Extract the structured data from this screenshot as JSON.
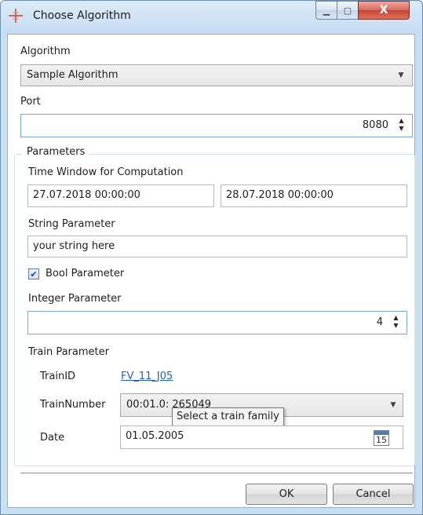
{
  "window": {
    "title": "Choose Algorithm",
    "controls": {
      "minimize": "▁",
      "maximize": "▢",
      "close": "X"
    }
  },
  "algorithm": {
    "label": "Algorithm",
    "selected": "Sample Algorithm"
  },
  "port": {
    "label": "Port",
    "value": "8080"
  },
  "parameters": {
    "group_label": "Parameters",
    "time_window": {
      "label": "Time Window for Computation",
      "start": "27.07.2018 00:00:00",
      "end": "28.07.2018 00:00:00"
    },
    "string_param": {
      "label": "String Parameter",
      "value": "your string here"
    },
    "bool_param": {
      "label": "Bool Parameter",
      "checked": true
    },
    "integer_param": {
      "label": "Integer Parameter",
      "value": "4"
    },
    "train": {
      "label": "Train Parameter",
      "train_id_label": "TrainID",
      "train_id_value": "FV_11_J05",
      "train_number_label": "TrainNumber",
      "train_number_value": "00:01.0: 265049",
      "train_number_tooltip": "Select a train family",
      "date_label": "Date",
      "date_value": "01.05.2005",
      "calendar_day": "15"
    }
  },
  "buttons": {
    "ok": "OK",
    "cancel": "Cancel"
  },
  "icons": {
    "app": "crosshair-icon",
    "dropdown": "chevron-down-icon",
    "spinner": "spin-arrows-icon",
    "calendar": "calendar-icon",
    "check": "checkmark-icon"
  },
  "colors": {
    "link": "#1c62c4",
    "title_bar": "#c6dcf1",
    "close_button": "#c7442f"
  }
}
